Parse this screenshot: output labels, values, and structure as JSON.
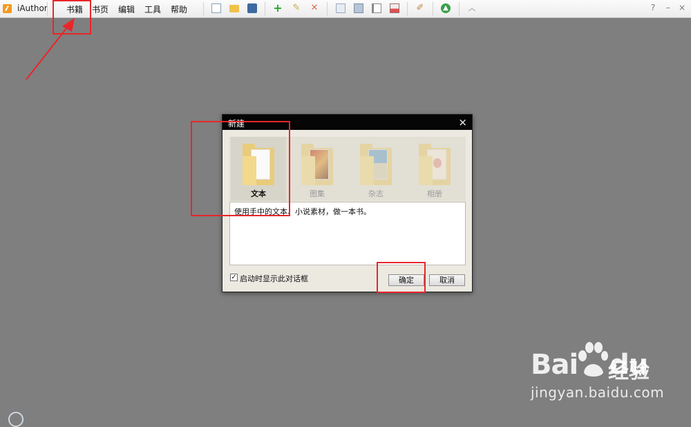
{
  "app": {
    "name": "iAuthor"
  },
  "menu": {
    "items": [
      "书籍",
      "书页",
      "编辑",
      "工具",
      "帮助"
    ]
  },
  "toolbar": {
    "icons": [
      "new-page-icon",
      "open-folder-icon",
      "save-icon",
      "add-icon",
      "edit-pencil-icon",
      "delete-icon",
      "page-layout-1-icon",
      "page-layout-2-icon",
      "page-layout-3-icon",
      "page-layout-4-icon",
      "tool-icon",
      "upload-icon",
      "collapse-icon"
    ]
  },
  "window_controls": {
    "help": "?",
    "minimize": "–",
    "close": "×"
  },
  "dialog": {
    "title": "新建",
    "close": "×",
    "types": [
      {
        "label": "文本",
        "icon": "text-folder-icon",
        "active": true
      },
      {
        "label": "图集",
        "icon": "photo-folder-icon",
        "active": false
      },
      {
        "label": "杂志",
        "icon": "magazine-folder-icon",
        "active": false
      },
      {
        "label": "相册",
        "icon": "album-folder-icon",
        "active": false
      }
    ],
    "description": "使用手中的文本、小说素材，做一本书。",
    "startup_checkbox": {
      "label": "启动时显示此对话框",
      "checked": true,
      "mark": "✓"
    },
    "ok_label": "确定",
    "cancel_label": "取消"
  },
  "annotation": {
    "color": "#e8262a"
  },
  "watermark": {
    "brand": "Bai",
    "brand2": "du",
    "product": "经验",
    "url": "jingyan.baidu.com"
  }
}
